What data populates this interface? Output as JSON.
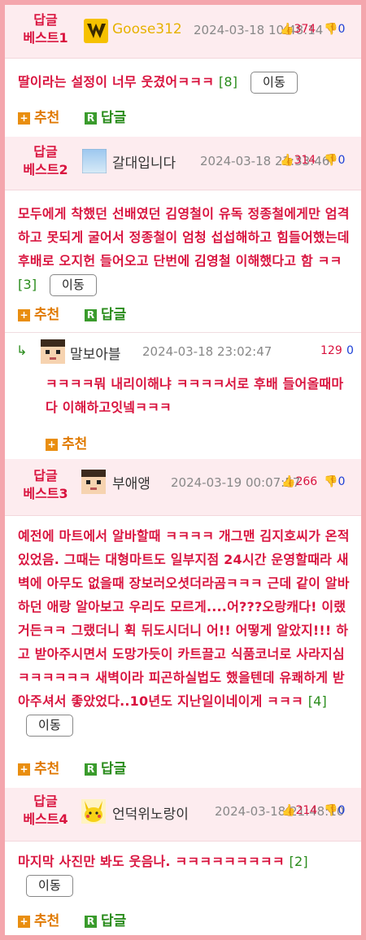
{
  "posts": [
    {
      "badge_line1": "답글",
      "badge_line2": "베스트1",
      "nickname": "Goose312",
      "date": "2024-03-18 10:48:14",
      "up": "374",
      "down": "0",
      "text": "딸이라는 설정이 너무 웃겼어ㅋㅋㅋ",
      "reply_count": "[8]",
      "move_label": "이동",
      "recommend_label": "추천",
      "reply_label": "답글",
      "avatar_icon": "yellow-logo-icon"
    },
    {
      "badge_line1": "답글",
      "badge_line2": "베스트2",
      "nickname": "갈대입니다",
      "date": "2024-03-18 22:33:46",
      "up": "314",
      "down": "0",
      "text": "모두에게 착했던 선배였던 김영철이 유독 정종철에게만 엄격하고 못되게 굴어서 정종철이 엄청 섭섭해하고 힘들어했는데 후배로 오지헌 들어오고 단번에 김영철 이해했다고 함 ㅋㅋ",
      "reply_count": "[3]",
      "move_label": "이동",
      "recommend_label": "추천",
      "reply_label": "답글",
      "avatar_icon": "sky-image-icon"
    },
    {
      "badge_line1": "답글",
      "badge_line2": "베스트3",
      "nickname": "부애앵",
      "date": "2024-03-19 00:07:57",
      "up": "266",
      "down": "0",
      "text": "예전에 마트에서 알바할때 ㅋㅋㅋㅋ 개그맨 김지호씨가 온적 있었음. 그때는 대형마트도 일부지점 24시간 운영할때라 새벽에 아무도 없을때 장보러오셧더라곰ㅋㅋㅋ 근데 같이 알바하던 애랑 알아보고 우리도 모르게....어???오랑캐다! 이랬거든ㅋㅋ 그랬더니 휙 뒤도시더니 어!! 어떻게 알았지!!! 하고 받아주시면서 도망가듯이 카트끌고 식품코너로 사라지심ㅋㅋㅋㅋㅋㅋ 새벽이라 피곤하실법도 했을텐데 유쾌하게 받아주셔서 좋았었다..10년도 지난일이네이게 ㅋㅋㅋ",
      "reply_count": "[4]",
      "move_label": "이동",
      "recommend_label": "추천",
      "reply_label": "답글",
      "avatar_icon": "pixel-face-icon"
    },
    {
      "badge_line1": "답글",
      "badge_line2": "베스트4",
      "nickname": "언덕위노랑이",
      "date": "2024-03-18 21:48:10",
      "up": "214",
      "down": "0",
      "text": "마지막 사진만 봐도 웃음나. ㅋㅋㅋㅋㅋㅋㅋㅋㅋ",
      "reply_count": "[2]",
      "move_label": "이동",
      "recommend_label": "추천",
      "reply_label": "답글",
      "avatar_icon": "pikachu-icon"
    }
  ],
  "sub_reply": {
    "nickname": "말보아블",
    "date": "2024-03-18 23:02:47",
    "up": "129",
    "down": "0",
    "text": "ㅋㅋㅋㅋ뭐 내리이해냐 ㅋㅋㅋㅋ서로 후배 들어올때마다 이해하고잇넼ㅋㅋㅋ",
    "recommend_label": "추천",
    "avatar_icon": "pixel-face-icon"
  },
  "colors": {
    "accent_red": "#d9143f",
    "frame_pink": "#f4a6ad",
    "header_bg": "#fdecef",
    "reply_green": "#2a8c1c",
    "recommend_orange": "#e07a00"
  }
}
